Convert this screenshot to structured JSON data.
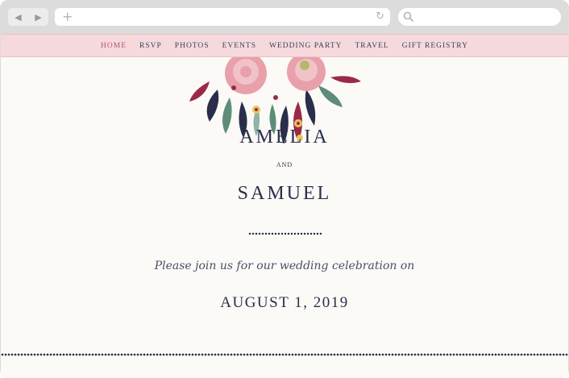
{
  "browser": {
    "back_icon": "◀",
    "forward_icon": "▶",
    "new_tab_icon": "+",
    "reload_icon": "↻",
    "address_value": "",
    "search_value": ""
  },
  "nav": {
    "items": [
      "HOME",
      "RSVP",
      "PHOTOS",
      "EVENTS",
      "WEDDING PARTY",
      "TRAVEL",
      "GIFT REGISTRY"
    ],
    "active": "HOME"
  },
  "couple": {
    "name1": "AMELIA",
    "and": "and",
    "name2": "SAMUEL"
  },
  "invite_text": "Please join us for our wedding celebration on",
  "date": "AUGUST 1, 2019",
  "colors": {
    "nav_bg": "#f6d9dc",
    "active_nav": "#b0546a",
    "text_navy": "#2a2e4a",
    "page_bg": "#fbfaf7"
  }
}
